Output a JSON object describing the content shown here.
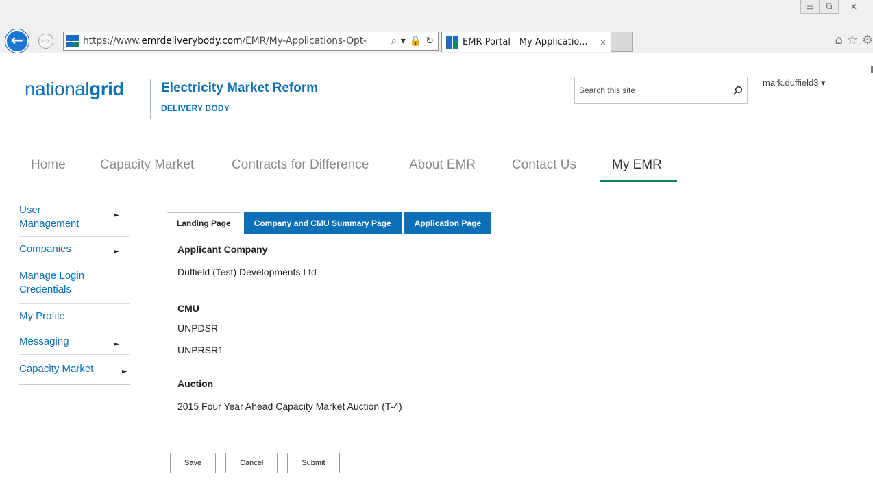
{
  "browser": {
    "window_controls": [
      "▭",
      "⧉",
      "✕"
    ],
    "url_prefix": "https://www.",
    "url_domain": "emrdeliverybody.com",
    "url_path": "/EMR/My-Applications-Opt-",
    "address_tools": [
      "⌕",
      "▾",
      "🔒",
      "↻"
    ],
    "tab_title": "EMR Portal - My-Applicatio...",
    "tab_close": "×",
    "toolbar_icons": [
      "⌂",
      "☆",
      "⚙"
    ]
  },
  "header": {
    "logo_light": "national",
    "logo_bold": "grid",
    "title": "Electricity Market Reform",
    "subtitle": "DELIVERY BODY",
    "search_placeholder": "Search this site",
    "user": "mark.duffield3 ▾"
  },
  "topnav": {
    "items": [
      "Home",
      "Capacity Market",
      "Contracts for Difference",
      "About EMR",
      "Contact Us",
      "My EMR"
    ],
    "active": "My EMR"
  },
  "sidebar": {
    "items": [
      {
        "label": "User Management",
        "arrow": "►"
      },
      {
        "label": "Companies",
        "arrow": "►"
      },
      {
        "label": "Manage Login Credentials",
        "arrow": ""
      },
      {
        "label": "My Profile",
        "arrow": ""
      },
      {
        "label": "Messaging",
        "arrow": "►"
      },
      {
        "label": "Capacity Market",
        "arrow": "►"
      }
    ]
  },
  "tabs": {
    "items": [
      "Landing Page",
      "Company and CMU Summary Page",
      "Application Page"
    ],
    "active": "Landing Page"
  },
  "content": {
    "applicant_label": "Applicant Company",
    "applicant_value": "Duffield (Test) Developments Ltd",
    "cmu_label": "CMU",
    "cmu_values": [
      "UNPDSR",
      "UNPRSR1"
    ],
    "auction_label": "Auction",
    "auction_value": "2015 Four Year Ahead Capacity Market Auction (T-4)"
  },
  "actions": {
    "save": "Save",
    "cancel": "Cancel",
    "submit": "Submit"
  }
}
